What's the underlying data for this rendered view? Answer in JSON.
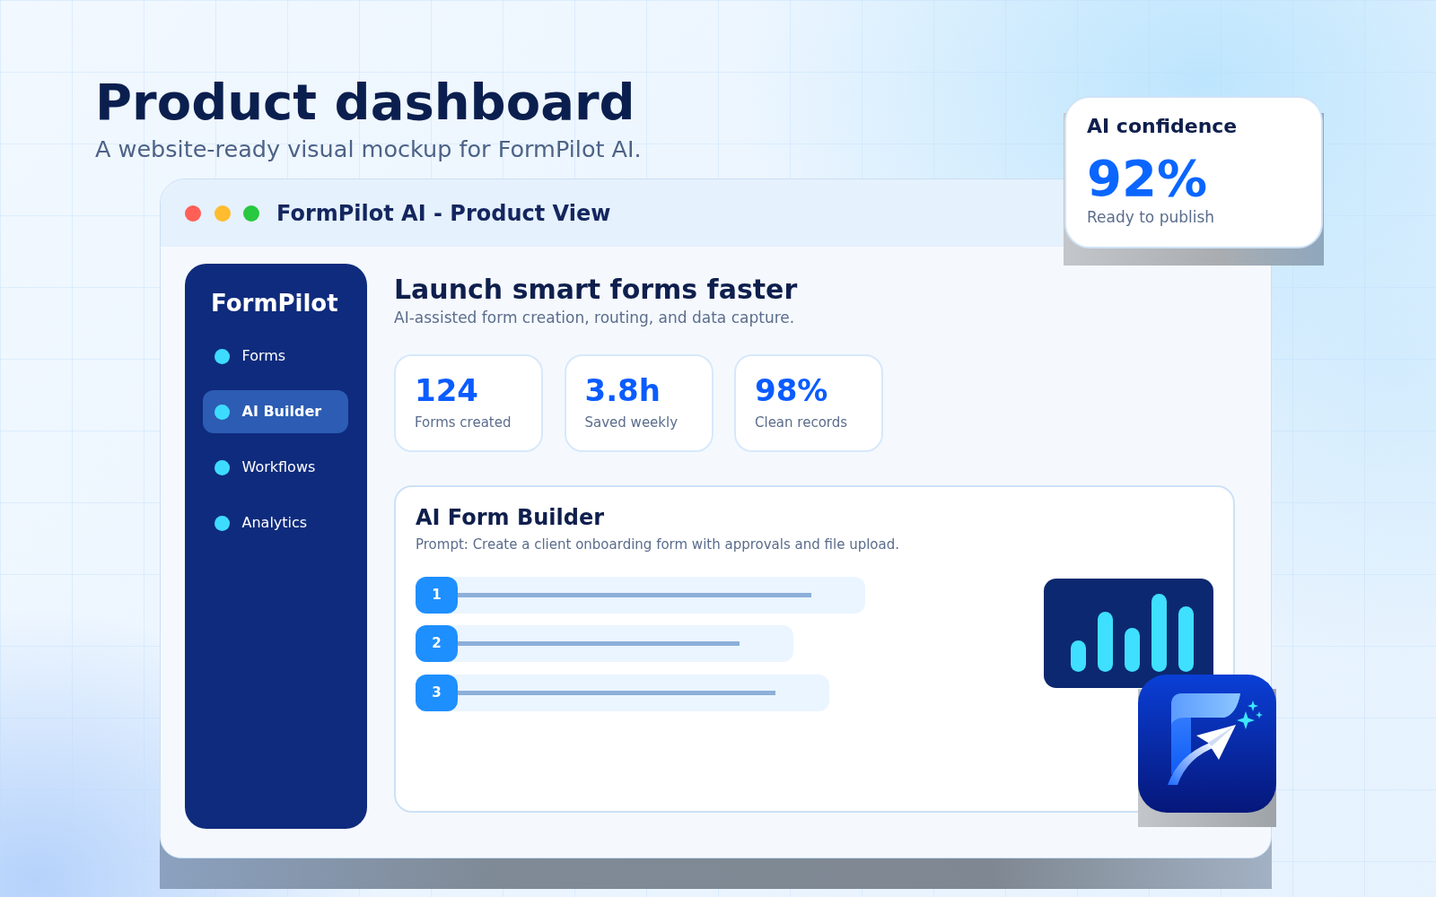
{
  "page": {
    "title": "Product dashboard",
    "subtitle": "A website-ready visual mockup for FormPilot AI."
  },
  "window": {
    "controls": [
      {
        "kind": "close"
      },
      {
        "kind": "minimize"
      },
      {
        "kind": "zoom"
      }
    ],
    "title": "FormPilot AI - Product View"
  },
  "sidebar": {
    "brand": "FormPilot",
    "items": [
      {
        "label": "Forms",
        "selected": false
      },
      {
        "label": "AI Builder",
        "selected": true
      },
      {
        "label": "Workflows",
        "selected": false
      },
      {
        "label": "Analytics",
        "selected": false
      }
    ]
  },
  "main": {
    "heading": "Launch smart forms faster",
    "subheading": "AI-assisted form creation, routing, and data capture.",
    "stats": [
      {
        "value": "124",
        "label": "Forms created"
      },
      {
        "value": "3.8h",
        "label": "Saved weekly"
      },
      {
        "value": "98%",
        "label": "Clean records"
      }
    ]
  },
  "builder": {
    "title": "AI Form Builder",
    "prompt": "Prompt: Create a client onboarding form with approvals and file upload.",
    "fields": [
      {
        "number": "1"
      },
      {
        "number": "2"
      },
      {
        "number": "3"
      }
    ]
  },
  "confidence": {
    "title": "AI confidence",
    "value": "92%",
    "caption": "Ready to publish"
  }
}
